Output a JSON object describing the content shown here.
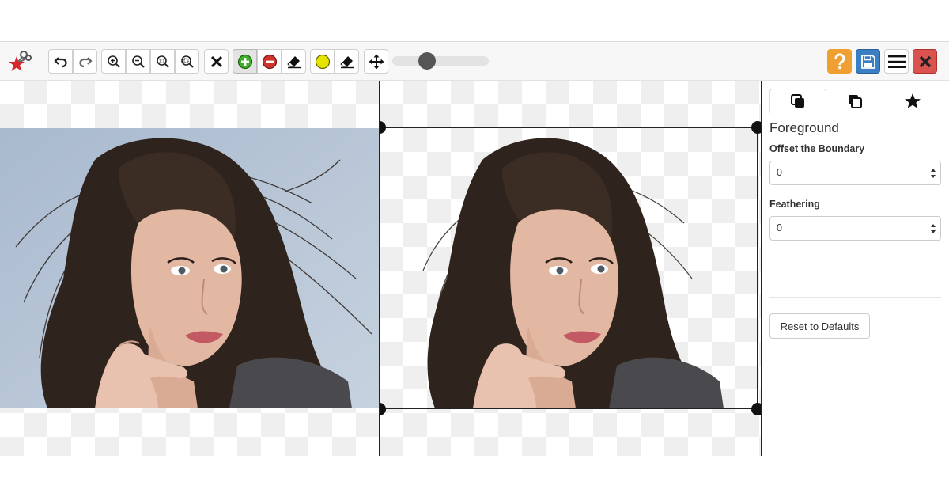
{
  "toolbar": {
    "logo": {
      "icon": "scissors-star-logo-icon"
    },
    "buttons": [
      {
        "name": "undo-button",
        "icon": "undo-arrow-icon"
      },
      {
        "name": "redo-button",
        "icon": "redo-arrow-icon"
      },
      {
        "name": "zoom-in-button",
        "icon": "zoom-in-icon"
      },
      {
        "name": "zoom-out-button",
        "icon": "zoom-out-icon"
      },
      {
        "name": "zoom-actual-size-button",
        "icon": "zoom-1to1-icon",
        "text": "1:1"
      },
      {
        "name": "zoom-fit-button",
        "icon": "zoom-fit-icon"
      },
      {
        "name": "clear-button",
        "icon": "close-x-icon"
      },
      {
        "name": "foreground-marker-button",
        "icon": "green-plus-icon",
        "active": true
      },
      {
        "name": "background-marker-button",
        "icon": "red-minus-icon"
      },
      {
        "name": "marker-eraser-button",
        "icon": "eraser-icon"
      },
      {
        "name": "hair-marker-button",
        "icon": "yellow-circle-icon"
      },
      {
        "name": "hair-eraser-button",
        "icon": "eraser-icon"
      },
      {
        "name": "pan-button",
        "icon": "move-arrows-icon"
      }
    ],
    "brush_size_fraction": 0.33,
    "right_buttons": [
      {
        "name": "help-button",
        "icon": "question-icon",
        "color": "#f0a032"
      },
      {
        "name": "save-button",
        "icon": "floppy-disk-icon",
        "color": "#3a7fc4"
      },
      {
        "name": "menu-button",
        "icon": "hamburger-menu-icon",
        "color": "#ffffff"
      },
      {
        "name": "close-button",
        "icon": "close-x-icon",
        "color": "#d9534f"
      }
    ]
  },
  "colors": {
    "accent_green": "#3fae29",
    "accent_red": "#d0342c",
    "accent_yellow": "#e4e400",
    "help": "#f0a032",
    "save": "#3a7fc4",
    "close": "#d9534f",
    "photo_background": "#b6c4d6"
  },
  "panel": {
    "tabs": [
      {
        "name": "tab-foreground",
        "icon": "layers-filled-icon",
        "active": true
      },
      {
        "name": "tab-background",
        "icon": "layers-outline-icon",
        "active": false
      },
      {
        "name": "tab-effects",
        "icon": "star-icon",
        "active": false
      }
    ],
    "title": "Foreground",
    "offset_label": "Offset the Boundary",
    "offset_value": "0",
    "feathering_label": "Feathering",
    "feathering_value": "0",
    "reset_label": "Reset to Defaults"
  }
}
